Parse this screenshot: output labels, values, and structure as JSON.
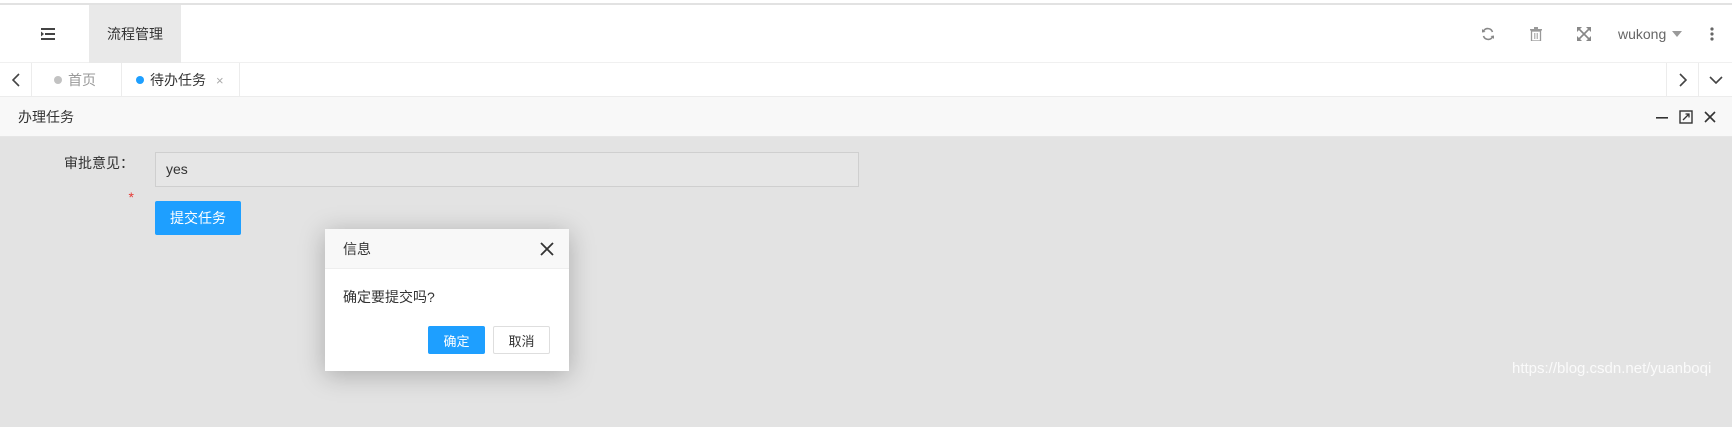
{
  "header": {
    "active_nav": "流程管理",
    "username": "wukong"
  },
  "tabs": [
    {
      "label": "首页",
      "dot_color": "#c2c2c2",
      "closable": false
    },
    {
      "label": "待办任务",
      "dot_color": "#1e9fff",
      "closable": true,
      "close_label": "×"
    }
  ],
  "panel": {
    "title": "办理任务"
  },
  "form": {
    "label": "审批意见：",
    "required_mark": "*",
    "value": "yes",
    "submit_label": "提交任务"
  },
  "dialog": {
    "title": "信息",
    "message": "确定要提交吗?",
    "ok_label": "确定",
    "cancel_label": "取消"
  },
  "watermark": "https://blog.csdn.net/yuanboqi",
  "colors": {
    "accent": "#1e9fff",
    "content_bg": "#e3e3e3"
  }
}
